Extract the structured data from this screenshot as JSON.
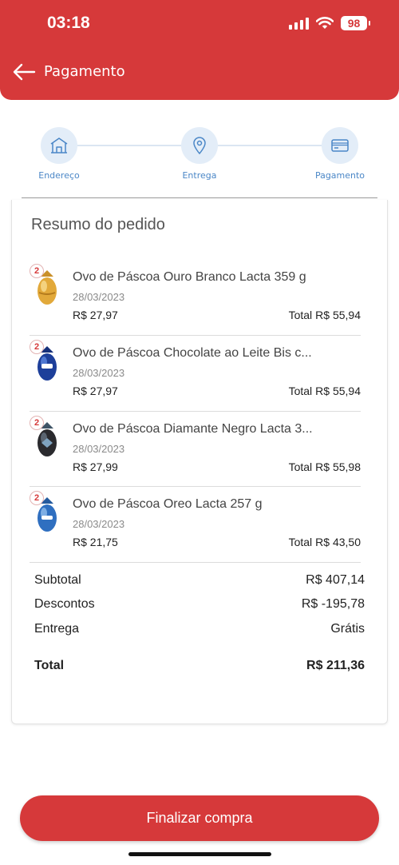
{
  "status_bar": {
    "time": "03:18",
    "battery": "98"
  },
  "header": {
    "title": "Pagamento"
  },
  "stepper": {
    "steps": [
      {
        "label": "Endereço",
        "icon": "house-icon"
      },
      {
        "label": "Entrega",
        "icon": "location-pin-icon"
      },
      {
        "label": "Pagamento",
        "icon": "credit-card-icon"
      }
    ]
  },
  "summary": {
    "title": "Resumo do pedido",
    "items": [
      {
        "qty": "2",
        "name": "Ovo de Páscoa Ouro Branco Lacta 359 g",
        "date": "28/03/2023",
        "price": "R$ 27,97",
        "total_label": "Total",
        "total": "R$ 55,94"
      },
      {
        "qty": "2",
        "name": "Ovo de Páscoa Chocolate ao Leite Bis c...",
        "date": "28/03/2023",
        "price": "R$ 27,97",
        "total_label": "Total",
        "total": "R$ 55,94"
      },
      {
        "qty": "2",
        "name": "Ovo de Páscoa Diamante Negro Lacta 3...",
        "date": "28/03/2023",
        "price": "R$ 27,99",
        "total_label": "Total",
        "total": "R$ 55,98"
      },
      {
        "qty": "2",
        "name": "Ovo de Páscoa Oreo Lacta 257 g",
        "date": "28/03/2023",
        "price": "R$ 21,75",
        "total_label": "Total",
        "total": "R$ 43,50"
      }
    ],
    "subtotal_label": "Subtotal",
    "subtotal": "R$ 407,14",
    "discount_label": "Descontos",
    "discount": "R$ -195,78",
    "delivery_label": "Entrega",
    "delivery": "Grátis",
    "total_label": "Total",
    "total": "R$ 211,36"
  },
  "footer": {
    "button_label": "Finalizar compra"
  },
  "colors": {
    "brand_red": "#d6393a",
    "step_blue": "#4b87c7",
    "step_bg": "#e3edf8"
  }
}
